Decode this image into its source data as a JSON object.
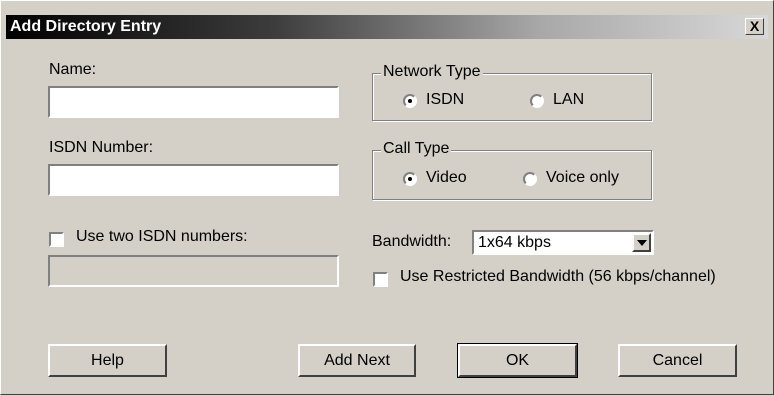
{
  "dialog": {
    "title": "Add Directory Entry",
    "close_glyph": "X"
  },
  "fields": {
    "name_label": "Name:",
    "name_value": "",
    "isdn_label": "ISDN Number:",
    "isdn_value": "",
    "two_isdn_label": "Use two  ISDN numbers:",
    "two_isdn_checked": false,
    "second_isdn_value": ""
  },
  "network_type": {
    "title": "Network Type",
    "options": [
      "ISDN",
      "LAN"
    ],
    "selected": "ISDN"
  },
  "call_type": {
    "title": "Call Type",
    "options": [
      "Video",
      "Voice only"
    ],
    "selected": "Video"
  },
  "bandwidth": {
    "label": "Bandwidth:",
    "value": "1x64 kbps",
    "restricted_label": "Use Restricted Bandwidth (56 kbps/channel)",
    "restricted_checked": false
  },
  "buttons": {
    "help": "Help",
    "add_next": "Add Next",
    "ok": "OK",
    "cancel": "Cancel"
  }
}
